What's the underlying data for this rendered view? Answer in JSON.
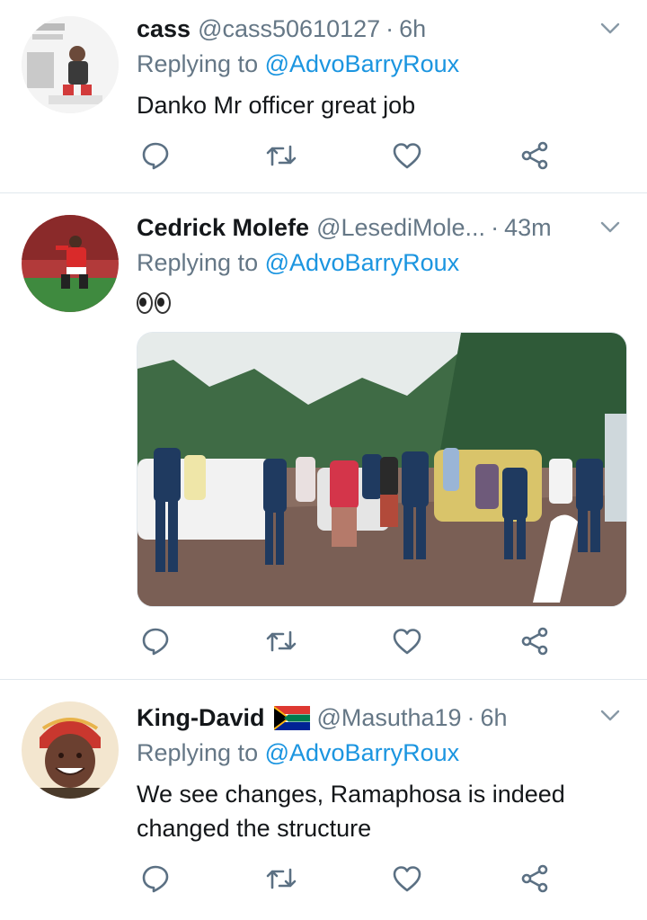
{
  "tweets": [
    {
      "name": "cass",
      "handle": "@cass50610127",
      "time": "6h",
      "replying_prefix": "Replying to",
      "mention": "@AdvoBarryRoux",
      "text": "Danko Mr officer great job"
    },
    {
      "name": "Cedrick Molefe",
      "handle": "@LesediMole...",
      "time": "43m",
      "replying_prefix": "Replying to",
      "mention": "@AdvoBarryRoux",
      "text": ""
    },
    {
      "name": "King-David",
      "handle": "@Masutha19",
      "time": "6h",
      "replying_prefix": "Replying to",
      "mention": "@AdvoBarryRoux",
      "text": "We see changes, Ramaphosa is indeed changed the structure"
    }
  ],
  "separator": "·",
  "colors": {
    "mention": "#1b95e0",
    "secondary": "#657786",
    "primary": "#14171a",
    "divider": "#e1e8ed",
    "icon": "#5b7083"
  }
}
